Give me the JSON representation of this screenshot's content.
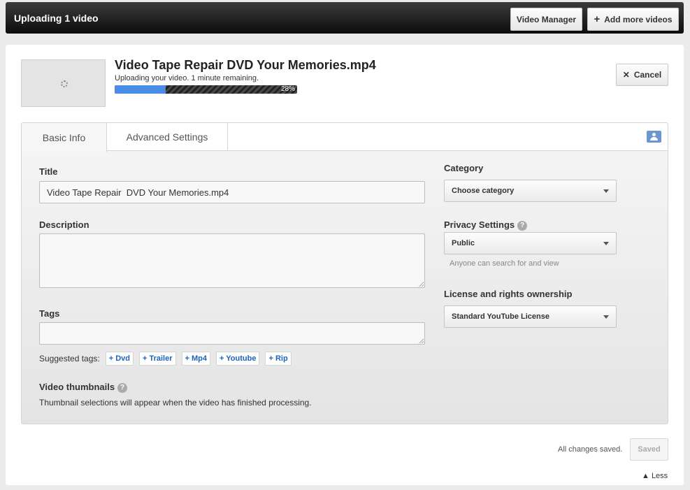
{
  "topbar": {
    "title": "Uploading 1 video",
    "video_manager_label": "Video Manager",
    "add_more_label": "Add more videos",
    "add_more_icon": "+"
  },
  "upload": {
    "video_title": "Video Tape Repair DVD Your Memories.mp4",
    "status": "Uploading your video. 1 minute remaining.",
    "progress": 0.28,
    "progress_label": "28%",
    "cancel_label": "Cancel",
    "cancel_icon": "✕"
  },
  "tabs": [
    {
      "label": "Basic Info",
      "active": true
    },
    {
      "label": "Advanced Settings",
      "active": false
    }
  ],
  "form": {
    "title_label": "Title",
    "title_value": "Video Tape Repair  DVD Your Memories.mp4",
    "description_label": "Description",
    "description_value": "",
    "tags_label": "Tags",
    "tags_value": "",
    "suggested_label": "Suggested tags:",
    "suggested_tags": [
      "+ Dvd",
      "+ Trailer",
      "+ Mp4",
      "+ Youtube",
      "+ Rip"
    ],
    "thumbnails_label": "Video thumbnails",
    "thumbnails_note": "Thumbnail selections will appear when the video has finished processing.",
    "help_icon": "?"
  },
  "settings": {
    "category_label": "Category",
    "category_value": "Choose category",
    "privacy_label": "Privacy Settings",
    "privacy_value": "Public",
    "privacy_hint": "Anyone can search for and view",
    "license_label": "License and rights ownership",
    "license_value": "Standard YouTube License"
  },
  "footer": {
    "status": "All changes saved.",
    "saved_label": "Saved",
    "less_label": "▲ Less"
  },
  "colors": {
    "progress_fill": "#4a8ce6",
    "tag_link": "#1c62b9"
  }
}
